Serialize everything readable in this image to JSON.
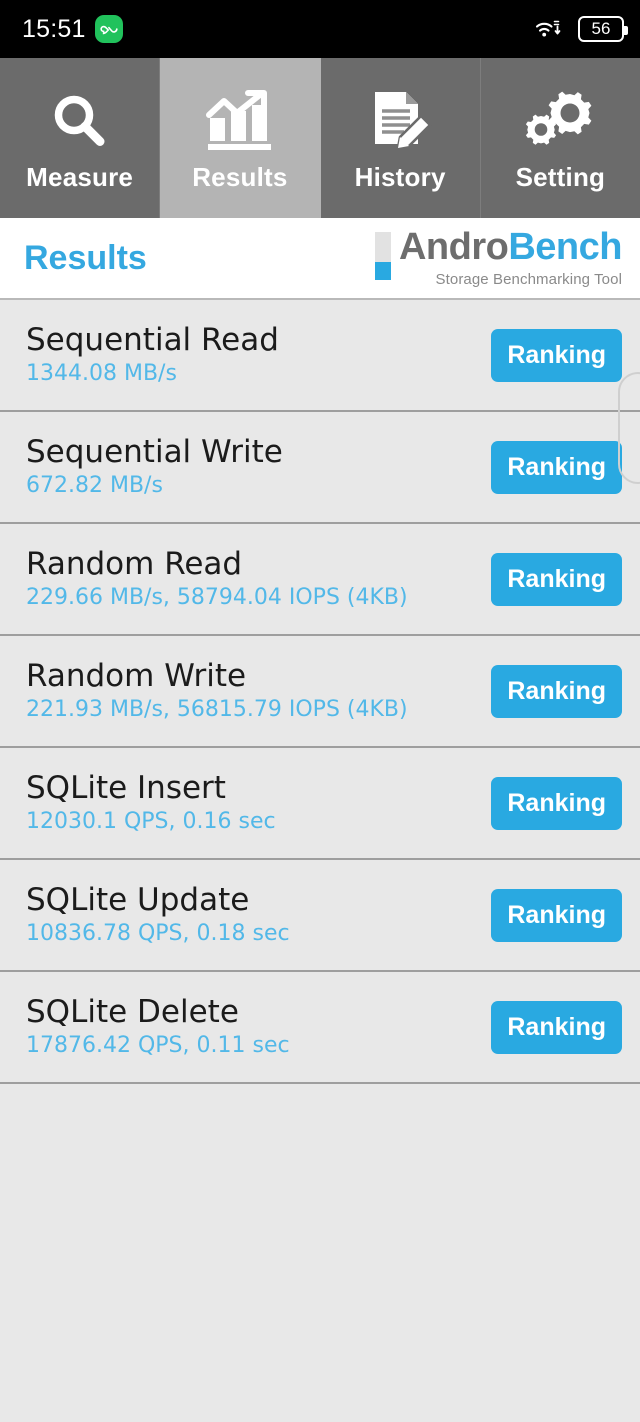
{
  "statusbar": {
    "time": "15:51",
    "app_badge_icon": "app-badge-icon",
    "wifi_icon": "wifi-icon",
    "battery_level": "56"
  },
  "tabs": [
    {
      "label": "Measure",
      "icon": "magnifier-icon",
      "active": false
    },
    {
      "label": "Results",
      "icon": "bar-chart-arrow-icon",
      "active": true
    },
    {
      "label": "History",
      "icon": "document-pencil-icon",
      "active": false
    },
    {
      "label": "Setting",
      "icon": "gears-icon",
      "active": false
    }
  ],
  "header": {
    "title": "Results",
    "brand_prefix": "Andro",
    "brand_suffix": "Bench",
    "tagline": "Storage Benchmarking Tool",
    "logo_bar_icon": "storage-gauge-icon"
  },
  "results": {
    "button_label": "Ranking",
    "rows": [
      {
        "title": "Sequential Read",
        "value": "1344.08 MB/s"
      },
      {
        "title": "Sequential Write",
        "value": "672.82 MB/s"
      },
      {
        "title": "Random Read",
        "value": "229.66 MB/s, 58794.04 IOPS (4KB)"
      },
      {
        "title": "Random Write",
        "value": "221.93 MB/s, 56815.79 IOPS (4KB)"
      },
      {
        "title": "SQLite Insert",
        "value": "12030.1 QPS, 0.16 sec"
      },
      {
        "title": "SQLite Update",
        "value": "10836.78 QPS, 0.18 sec"
      },
      {
        "title": "SQLite Delete",
        "value": "17876.42 QPS, 0.11 sec"
      }
    ]
  },
  "colors": {
    "accent_blue": "#29a9e1",
    "value_blue": "#52b8e8",
    "tab_inactive": "#6b6b6b",
    "tab_active": "#b4b4b4",
    "list_bg": "#e8e8e8"
  }
}
